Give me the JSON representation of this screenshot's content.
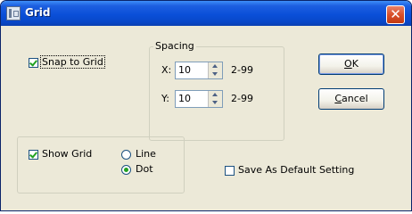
{
  "window": {
    "title": "Grid",
    "close_symbol": "✕"
  },
  "snap": {
    "label": "Snap to Grid",
    "checked": true
  },
  "spacing": {
    "title": "Spacing",
    "x": {
      "label": "X:",
      "value": "10",
      "range": "2-99"
    },
    "y": {
      "label": "Y:",
      "value": "10",
      "range": "2-99"
    }
  },
  "buttons": {
    "ok": {
      "mnemonic": "O",
      "rest": "K"
    },
    "cancel": {
      "mnemonic": "C",
      "rest": "ancel"
    }
  },
  "show_grid": {
    "label": "Show Grid",
    "checked": true
  },
  "style": {
    "line": {
      "label": "Line",
      "selected": false
    },
    "dot": {
      "label": "Dot",
      "selected": true
    }
  },
  "save_default": {
    "label": "Save As Default Setting",
    "checked": false
  },
  "icons": {
    "app": "grid-app-icon",
    "close": "close-icon",
    "up": "spin-up-arrow-icon",
    "down": "spin-down-arrow-icon"
  },
  "colors": {
    "titlebar": "#0a4fd8",
    "close": "#d9502a",
    "check": "#21a121",
    "dialog": "#ece9d8"
  }
}
